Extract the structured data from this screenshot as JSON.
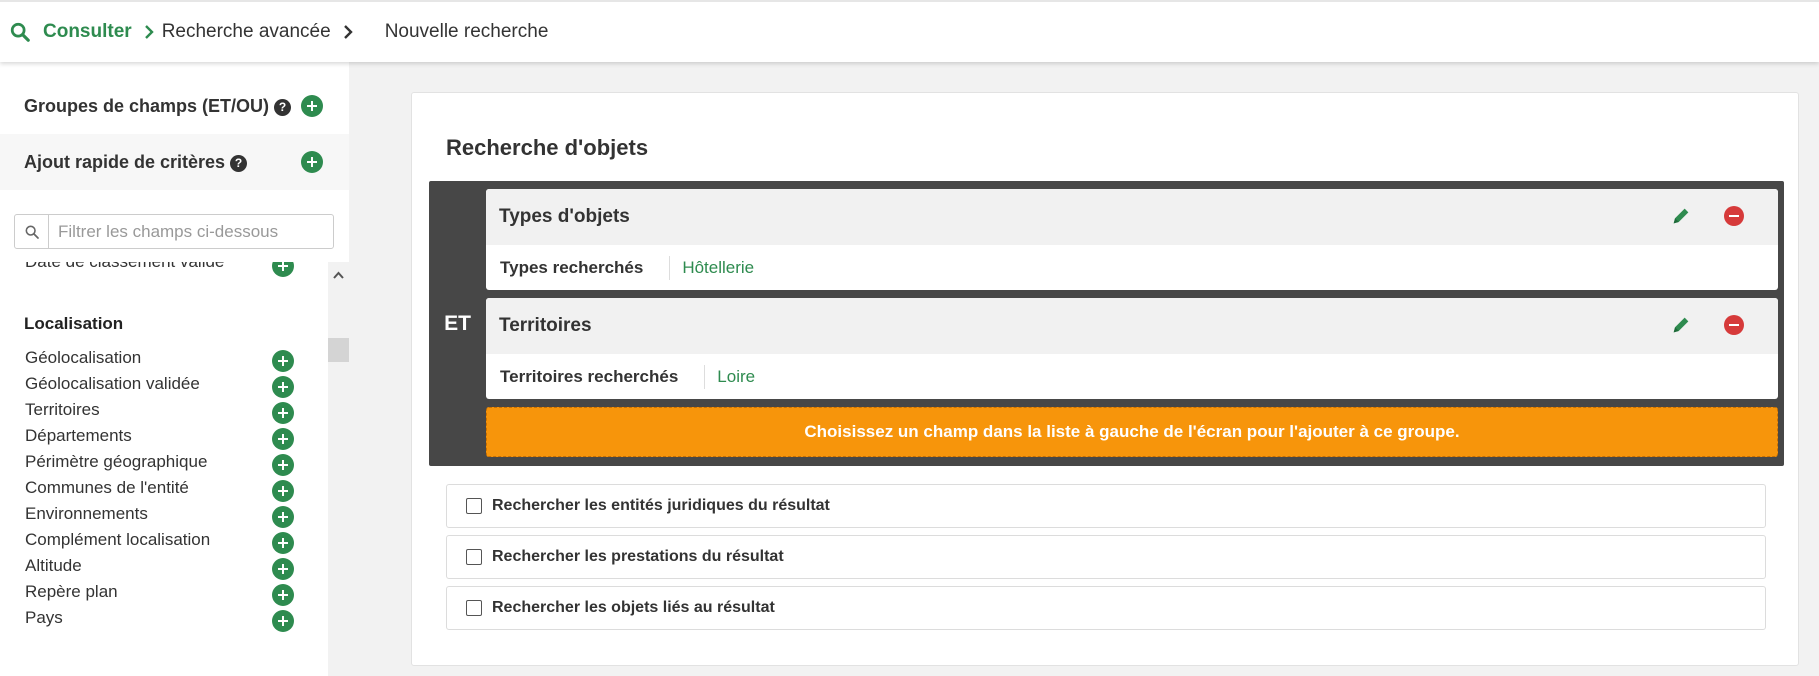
{
  "colors": {
    "accent": "#2e8b4f",
    "danger": "#d63a3a",
    "warning": "#f7950b",
    "group_bg": "#474747"
  },
  "breadcrumb": {
    "root": "Consulter",
    "level2": "Recherche avancée",
    "current": "Nouvelle recherche",
    "icons": [
      "search-icon",
      "chevron-right-icon"
    ]
  },
  "sidebar": {
    "groups_title": "Groupes de champs (ET/OU)",
    "quick_add_title": "Ajout rapide de critères",
    "help_glyph": "?",
    "filter_placeholder": "Filtrer les champs ci-dessous",
    "partial_item": "Date de classement validé",
    "section_title": "Localisation",
    "items": [
      {
        "label": "Géolocalisation"
      },
      {
        "label": "Géolocalisation validée"
      },
      {
        "label": "Territoires"
      },
      {
        "label": "Départements"
      },
      {
        "label": "Périmètre géographique"
      },
      {
        "label": "Communes de l'entité"
      },
      {
        "label": "Environnements"
      },
      {
        "label": "Complément localisation"
      },
      {
        "label": "Altitude"
      },
      {
        "label": "Repère plan"
      },
      {
        "label": "Pays"
      }
    ]
  },
  "main": {
    "title": "Recherche d'objets",
    "group_operator": "ET",
    "criteria": [
      {
        "name": "Types d'objets",
        "field": "Types recherchés",
        "value": "Hôtellerie"
      },
      {
        "name": "Territoires",
        "field": "Territoires recherchés",
        "value": "Loire"
      }
    ],
    "add_hint": "Choisissez un champ dans la liste à gauche de l'écran pour l'ajouter à ce groupe.",
    "options": [
      {
        "label": "Rechercher les entités juridiques du résultat",
        "checked": false
      },
      {
        "label": "Rechercher les prestations du résultat",
        "checked": false
      },
      {
        "label": "Rechercher les objets liés au résultat",
        "checked": false
      }
    ]
  }
}
